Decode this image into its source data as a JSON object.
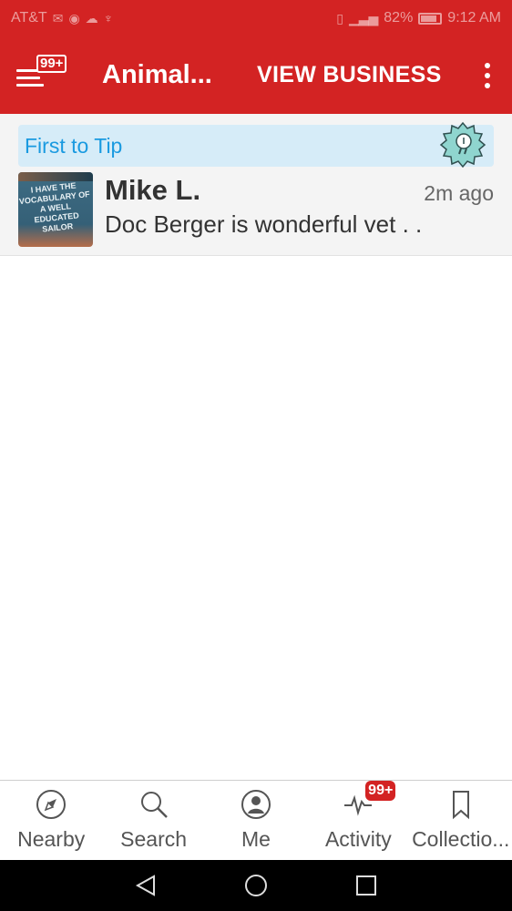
{
  "status_bar": {
    "carrier": "AT&T",
    "battery_percent": "82%",
    "time": "9:12 AM"
  },
  "app_bar": {
    "menu_badge": "99+",
    "title": "Animal...",
    "view_business": "VIEW BUSINESS"
  },
  "tip": {
    "first_to_tip": "First to Tip",
    "user_name": "Mike L.",
    "time_ago": "2m ago",
    "text": "Doc Berger is wonderful vet . .",
    "avatar_caption": "I HAVE THE VOCABULARY OF A WELL EDUCATED SAILOR"
  },
  "bottom_nav": {
    "items": [
      {
        "label": "Nearby",
        "icon": "compass-icon"
      },
      {
        "label": "Search",
        "icon": "search-icon"
      },
      {
        "label": "Me",
        "icon": "profile-icon"
      },
      {
        "label": "Activity",
        "icon": "activity-icon",
        "badge": "99+"
      },
      {
        "label": "Collectio...",
        "icon": "bookmark-icon"
      }
    ]
  },
  "colors": {
    "brand_red": "#d32323",
    "tip_blue": "#1a9ae0",
    "tip_banner_bg": "#d6ecf8"
  }
}
